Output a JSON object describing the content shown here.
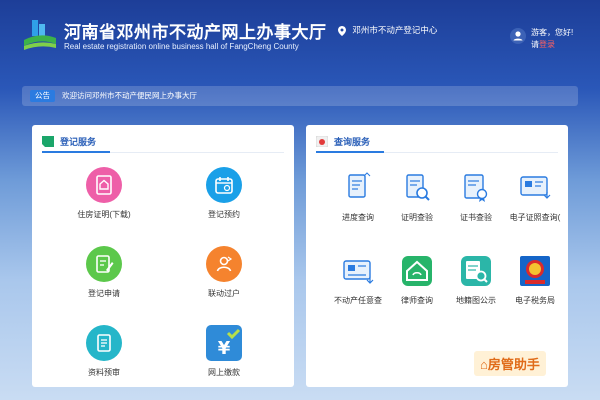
{
  "header": {
    "title_zh": "河南省邓州市不动产网上办事大厅",
    "title_en": "Real estate registration online business hall of FangCheng County",
    "location": "邓州市不动产登记中心",
    "greeting": "游客，您好!",
    "login_prefix": "请",
    "login_link": "登录"
  },
  "notice": {
    "badge": "公告",
    "text": "欢迎访问邓州市不动产便民网上办事大厅"
  },
  "register_panel": {
    "title": "登记服务",
    "items": [
      {
        "label": "住房证明(下载)",
        "icon": "house-certificate-icon",
        "color": "#ee5fa8"
      },
      {
        "label": "登记预约",
        "icon": "calendar-appointment-icon",
        "color": "#1aa0e8"
      },
      {
        "label": "登记申请",
        "icon": "edit-form-icon",
        "color": "#5cc84b"
      },
      {
        "label": "联动过户",
        "icon": "transfer-person-icon",
        "color": "#f5832e"
      },
      {
        "label": "资料预审",
        "icon": "document-review-icon",
        "color": "#25b6c9"
      },
      {
        "label": "网上缴款",
        "icon": "yuan-payment-icon",
        "color": "#2f8bd8"
      }
    ]
  },
  "query_panel": {
    "title": "查询服务",
    "items": [
      {
        "label": "进度查询",
        "icon": "progress-doc-icon"
      },
      {
        "label": "证明查验",
        "icon": "certificate-verify-icon"
      },
      {
        "label": "证书查验",
        "icon": "certificate-seal-icon"
      },
      {
        "label": "电子证照查询(",
        "icon": "e-license-icon"
      },
      {
        "label": "不动产任意查",
        "icon": "property-query-icon"
      },
      {
        "label": "律师查询",
        "icon": "lawyer-house-icon"
      },
      {
        "label": "地籍图公示",
        "icon": "cadastral-map-icon"
      },
      {
        "label": "电子税务局",
        "icon": "tax-bureau-icon"
      }
    ]
  },
  "watermark": "房管助手",
  "colors": {
    "accent": "#2a7be0",
    "header_bg": "#1d3e98",
    "login": "#ff6060"
  }
}
